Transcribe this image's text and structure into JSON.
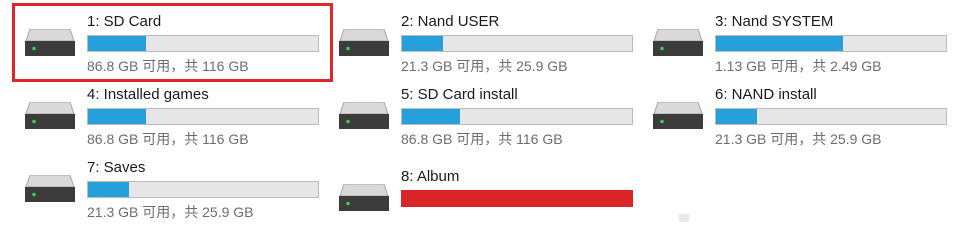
{
  "drives": [
    {
      "name": "1: SD Card",
      "free": "86.8 GB 可用，共 116 GB",
      "used_fraction": 0.25,
      "full": false,
      "selected": true
    },
    {
      "name": "2: Nand USER",
      "free": "21.3 GB 可用，共 25.9 GB",
      "used_fraction": 0.18,
      "full": false,
      "selected": false
    },
    {
      "name": "3: Nand SYSTEM",
      "free": "1.13 GB 可用，共 2.49 GB",
      "used_fraction": 0.55,
      "full": false,
      "selected": false
    },
    {
      "name": "4: Installed games",
      "free": "86.8 GB 可用，共 116 GB",
      "used_fraction": 0.25,
      "full": false,
      "selected": false
    },
    {
      "name": "5: SD Card install",
      "free": "86.8 GB 可用，共 116 GB",
      "used_fraction": 0.25,
      "full": false,
      "selected": false
    },
    {
      "name": "6: NAND install",
      "free": "21.3 GB 可用，共 25.9 GB",
      "used_fraction": 0.18,
      "full": false,
      "selected": false
    },
    {
      "name": "7: Saves",
      "free": "21.3 GB 可用，共 25.9 GB",
      "used_fraction": 0.18,
      "full": false,
      "selected": false
    },
    {
      "name": "8: Album",
      "free": "",
      "used_fraction": 1.0,
      "full": true,
      "selected": false
    }
  ],
  "colors": {
    "bar_fill": "#26a0da",
    "bar_full": "#da2626",
    "selection_border": "#e0262b"
  },
  "icon": "hard-drive-icon"
}
